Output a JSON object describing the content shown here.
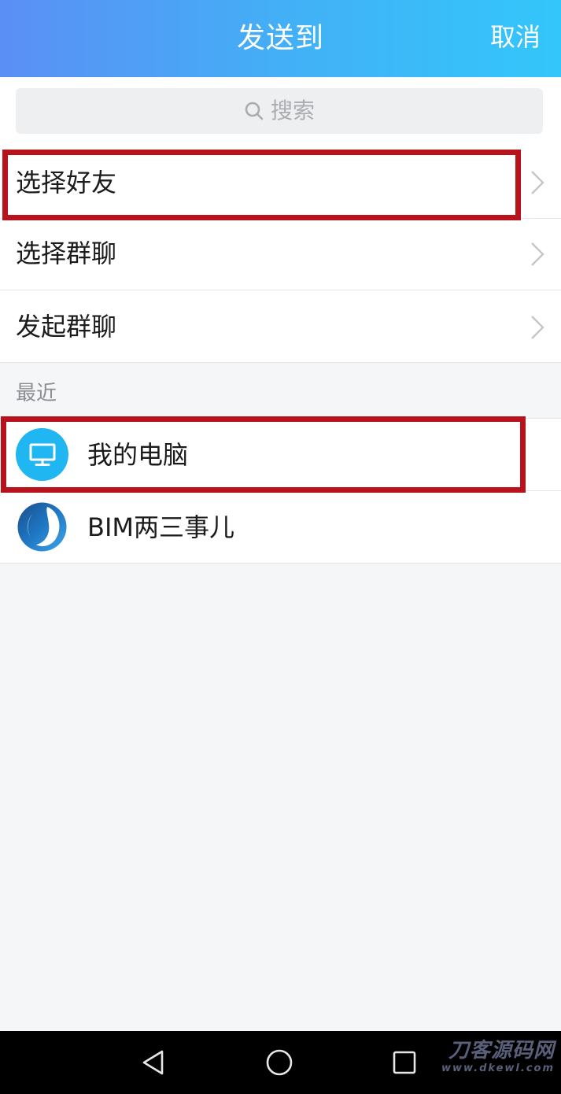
{
  "header": {
    "title": "发送到",
    "cancel_label": "取消"
  },
  "search": {
    "placeholder": "搜索"
  },
  "menu": {
    "items": [
      {
        "label": "选择好友",
        "highlighted": true
      },
      {
        "label": "选择群聊",
        "highlighted": false
      },
      {
        "label": "发起群聊",
        "highlighted": false
      }
    ]
  },
  "recent": {
    "section_label": "最近",
    "contacts": [
      {
        "name": "我的电脑",
        "avatar": "computer-icon",
        "highlighted": true
      },
      {
        "name": "BIM两三事儿",
        "avatar": "bim-logo",
        "highlighted": false
      }
    ]
  },
  "watermark": {
    "main": "刀客源码网",
    "sub": "www.dkewl.com"
  },
  "colors": {
    "header_start": "#5b8ff5",
    "header_end": "#33c6fb",
    "highlight": "#b8131c",
    "computer_avatar": "#1fb6f2",
    "background": "#f5f6f8"
  }
}
